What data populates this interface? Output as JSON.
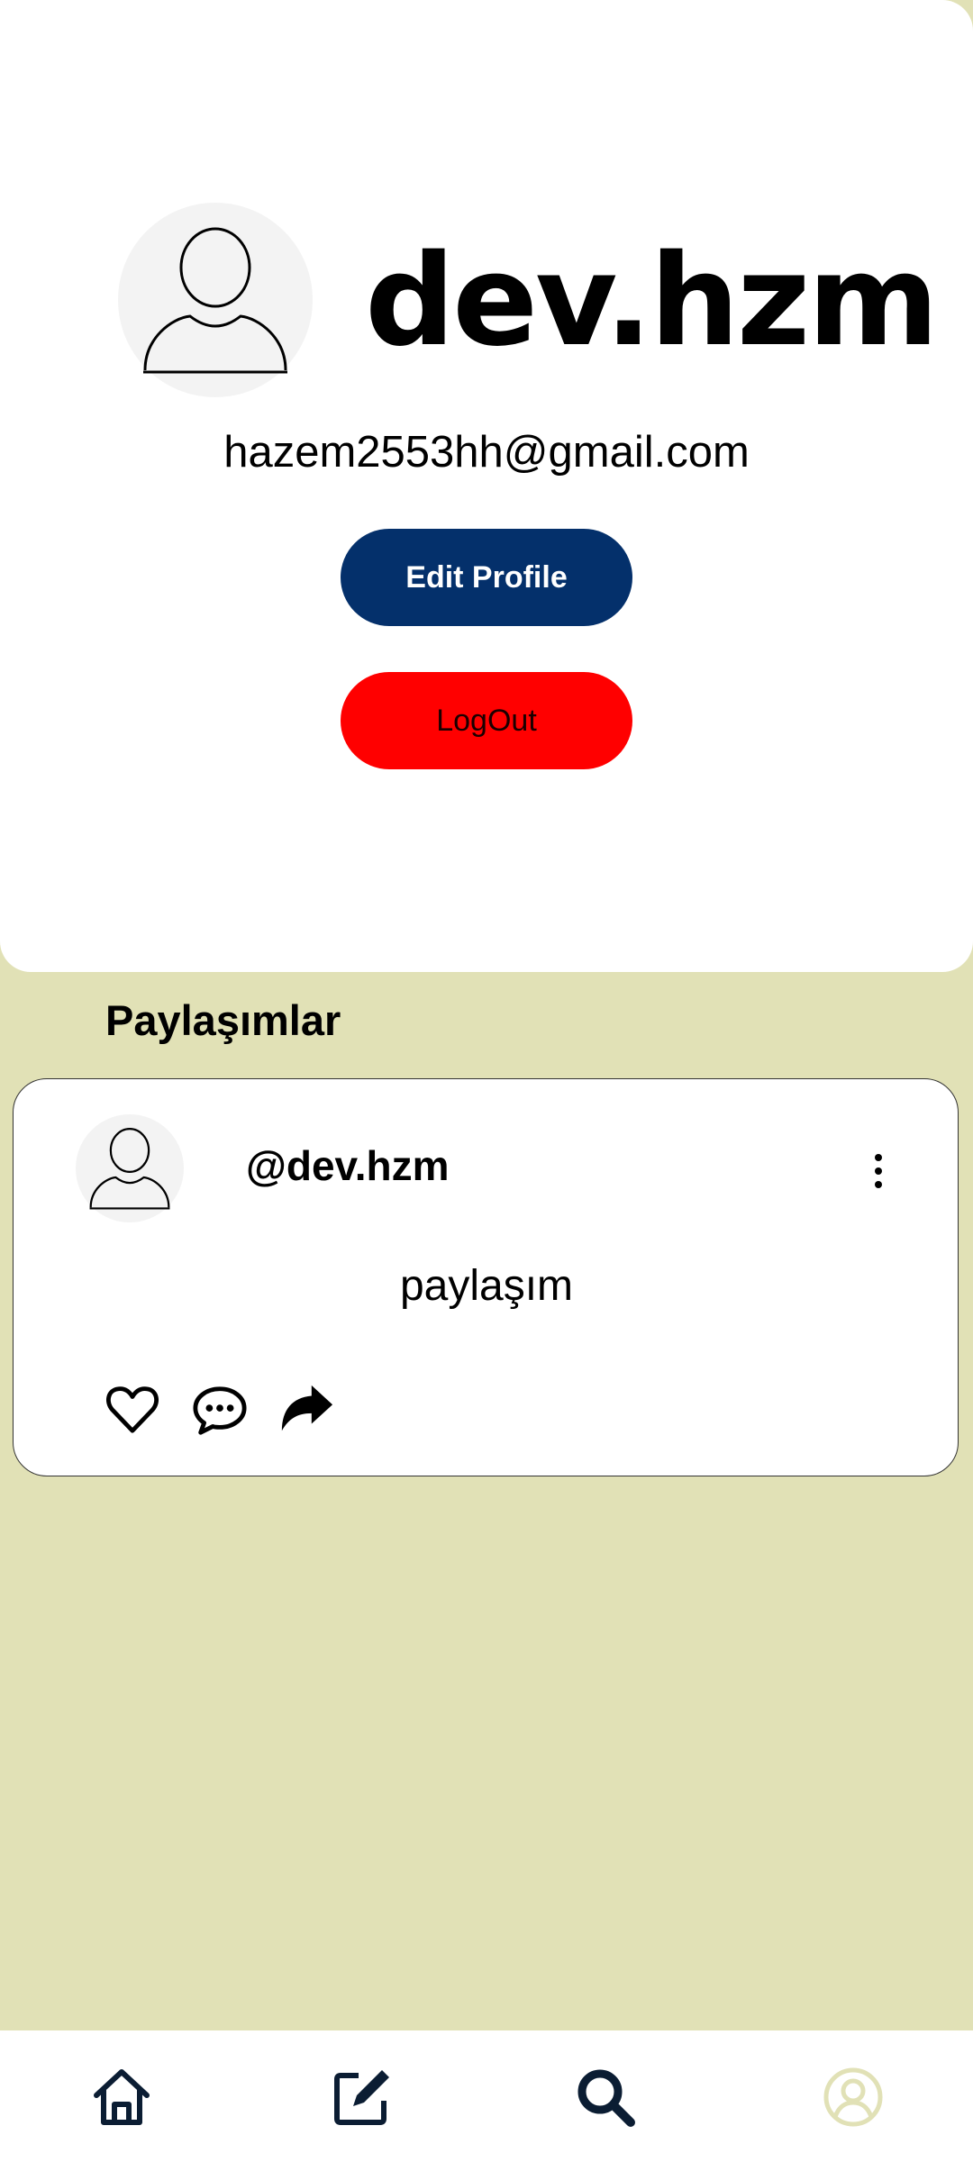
{
  "profile": {
    "username": "dev.hzm",
    "email": "hazem2553hh@gmail.com",
    "edit_label": "Edit Profile",
    "logout_label": "LogOut"
  },
  "posts_section": {
    "title": "Paylaşımlar",
    "posts": [
      {
        "author": "@dev.hzm",
        "text": "paylaşım",
        "actions": [
          "heart-icon",
          "comment-icon",
          "share-icon"
        ]
      }
    ]
  },
  "bottom_nav": {
    "items": [
      "home-icon",
      "edit-icon",
      "search-icon",
      "profile-icon"
    ],
    "active": "profile-icon"
  },
  "colors": {
    "background": "#e1e1b6",
    "edit_button": "#04306b",
    "logout_button": "#ff0000",
    "active_nav": "#e1e1b6"
  }
}
